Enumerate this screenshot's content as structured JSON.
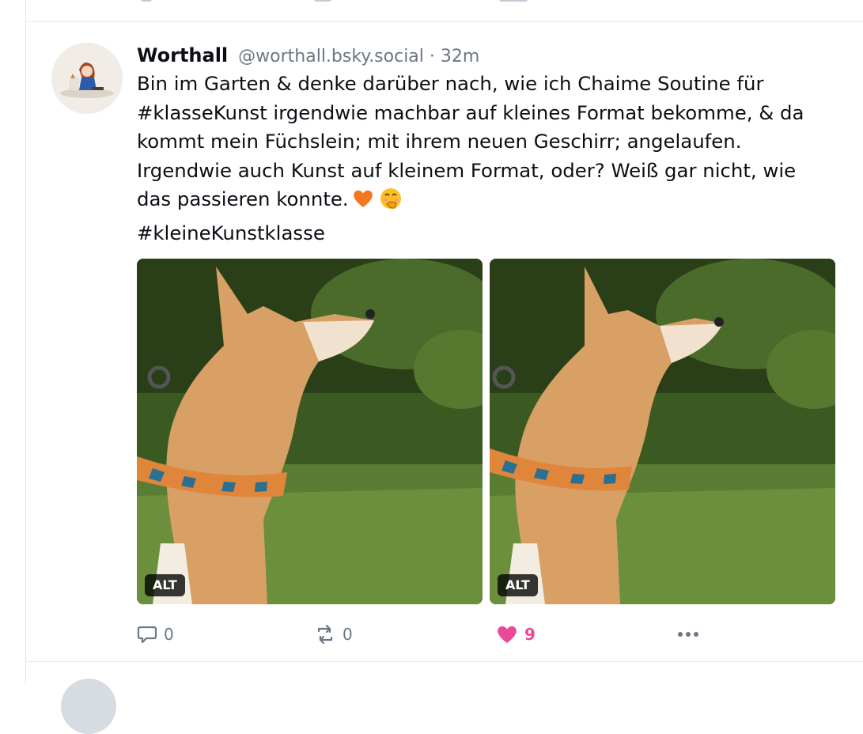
{
  "post": {
    "author_name": "Worthall",
    "handle": "@worthall.bsky.social",
    "separator": "·",
    "time": "32m",
    "text_lines": [
      "Bin im Garten & denke darüber nach, wie ich Chaime Soutine für",
      "#klasseKunst irgendwie machbar auf kleines Format bekomme, & da",
      "kommt mein Füchslein; mit ihrem neuen Geschirr; angelaufen.",
      "Irgendwie auch Kunst auf kleinem Format, oder? Weiß gar nicht, wie",
      "das passieren konnte.",
      "#kleineKunstklasse"
    ],
    "emojis": [
      "orange-heart",
      "face-with-hand-over-mouth"
    ],
    "images": [
      {
        "alt_badge": "ALT"
      },
      {
        "alt_badge": "ALT"
      }
    ],
    "actions": {
      "reply_count": "0",
      "repost_count": "0",
      "like_count": "9"
    }
  },
  "colors": {
    "like_active": "#ec4899",
    "muted_text": "#6c7784",
    "divider": "#e5e8ec"
  }
}
